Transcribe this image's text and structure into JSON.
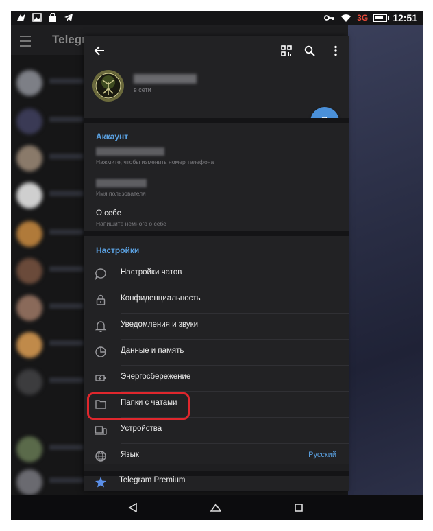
{
  "status_bar": {
    "time": "12:51",
    "network": "3G",
    "left_icons": [
      "signal-app-icon",
      "image-icon",
      "lock-icon",
      "telegram-icon"
    ],
    "right_icons": [
      "key-icon",
      "wifi-icon",
      "battery-icon"
    ]
  },
  "background": {
    "app_title": "Telegra"
  },
  "drawer": {
    "toolbar": {
      "back_icon": "arrow-left-icon",
      "qr_icon": "qr-code-icon",
      "search_icon": "search-icon",
      "more_icon": "more-vertical-icon"
    },
    "profile": {
      "status": "в сети",
      "camera_icon": "add-photo-icon"
    },
    "account": {
      "title": "Аккаунт",
      "phone_hint": "Нажмите, чтобы изменить номер телефона",
      "username_hint": "Имя пользователя",
      "about_title": "О себе",
      "about_hint": "Напишите немного о себе"
    },
    "settings": {
      "title": "Настройки",
      "items": [
        {
          "label": "Настройки чатов",
          "icon": "chat-bubble-icon",
          "value": ""
        },
        {
          "label": "Конфиденциальность",
          "icon": "lock-icon",
          "value": ""
        },
        {
          "label": "Уведомления и звуки",
          "icon": "bell-icon",
          "value": ""
        },
        {
          "label": "Данные и память",
          "icon": "pie-chart-icon",
          "value": ""
        },
        {
          "label": "Энергосбережение",
          "icon": "battery-saver-icon",
          "value": ""
        },
        {
          "label": "Папки с чатами",
          "icon": "folder-icon",
          "value": ""
        },
        {
          "label": "Устройства",
          "icon": "devices-icon",
          "value": ""
        },
        {
          "label": "Язык",
          "icon": "globe-icon",
          "value": "Русский"
        }
      ]
    },
    "premium": {
      "label": "Telegram Premium",
      "icon": "star-icon"
    }
  },
  "nav_bar": {
    "icons": [
      "back-triangle-icon",
      "home-icon",
      "recents-icon"
    ]
  },
  "colors": {
    "accent": "#5aa0e0",
    "highlight": "#e0272d",
    "fab": "#4a90d9",
    "premium_star": "#5b8fe8"
  }
}
